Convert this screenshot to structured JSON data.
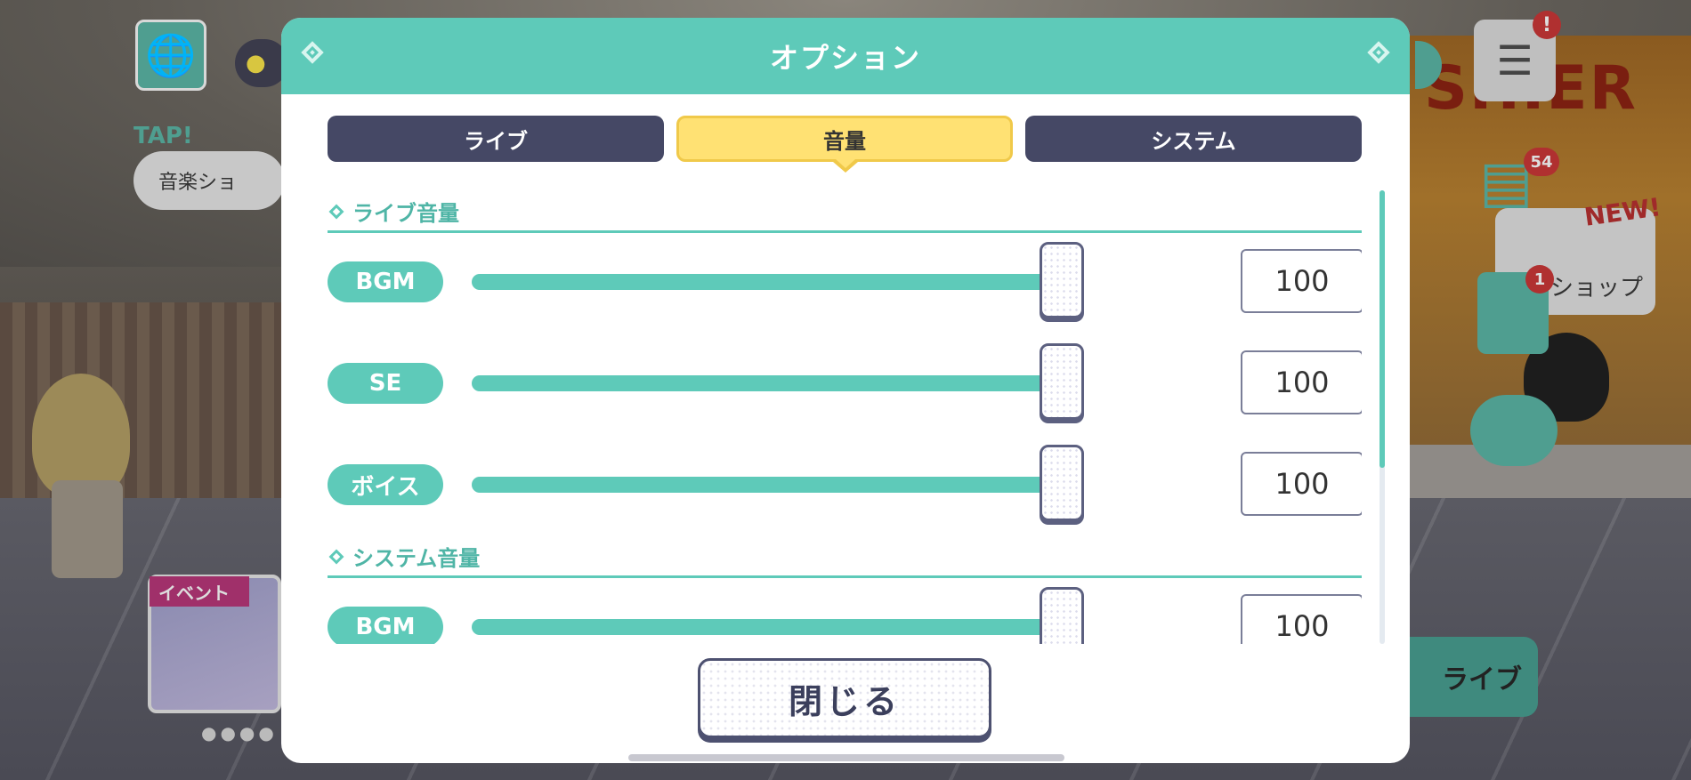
{
  "background": {
    "location_label": "音楽ショ",
    "tap_label": "TAP!",
    "cashier_sign": "SHIER",
    "menu_badge": "!",
    "gift_badge": "54",
    "new_badge": "NEW!",
    "shop_label": "ショップ",
    "list_badge": "1",
    "event_tag": "イベント",
    "live_button": "ライブ"
  },
  "modal": {
    "title": "オプション",
    "tabs": [
      {
        "label": "ライブ",
        "active": false
      },
      {
        "label": "音量",
        "active": true
      },
      {
        "label": "システム",
        "active": false
      }
    ],
    "sections": [
      {
        "title": "ライブ音量",
        "rows": [
          {
            "label": "BGM",
            "value": "100"
          },
          {
            "label": "SE",
            "value": "100"
          },
          {
            "label": "ボイス",
            "value": "100"
          }
        ]
      },
      {
        "title": "システム音量",
        "rows": [
          {
            "label": "BGM",
            "value": "100"
          }
        ]
      }
    ],
    "close_label": "閉じる"
  },
  "colors": {
    "accent": "#5ecab9",
    "tab_inactive": "#454865",
    "tab_active": "#ffe173"
  }
}
